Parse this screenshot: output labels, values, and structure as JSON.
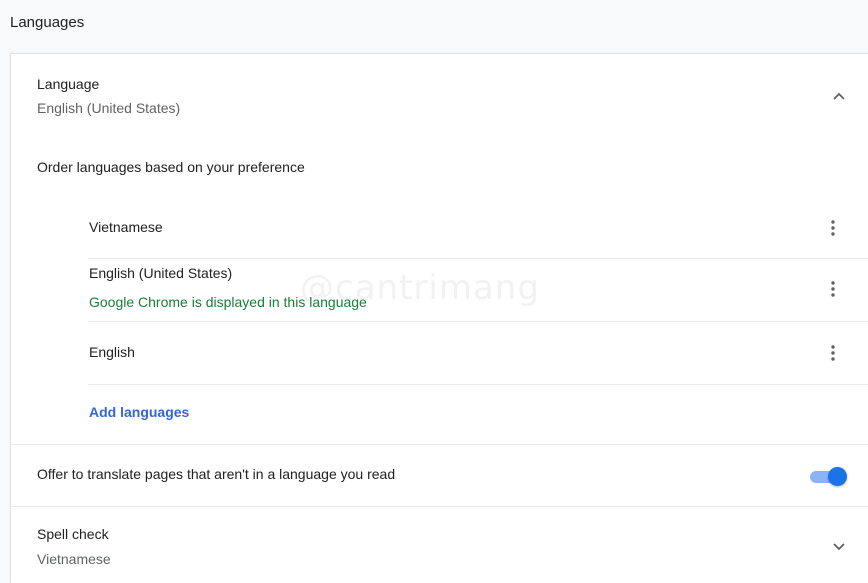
{
  "section_title": "Languages",
  "language": {
    "title": "Language",
    "value": "English (United States)",
    "expanded_icon": "chevron-up-icon"
  },
  "order_text": "Order languages based on your preference",
  "languages": [
    {
      "name": "Vietnamese",
      "note": ""
    },
    {
      "name": "English (United States)",
      "note": "Google Chrome is displayed in this language"
    },
    {
      "name": "English",
      "note": ""
    }
  ],
  "menu_icon": "more-vert-icon",
  "add_languages": "Add languages",
  "translate": {
    "label": "Offer to translate pages that aren't in a language you read",
    "enabled": true
  },
  "spell_check": {
    "title": "Spell check",
    "value": "Vietnamese",
    "collapsed_icon": "chevron-down-icon"
  },
  "watermark": "@cantrimang",
  "colors": {
    "accent": "#1a73e8",
    "link": "#3367d6",
    "note_green": "#188038",
    "toggle_track": "#8ab4f8"
  }
}
